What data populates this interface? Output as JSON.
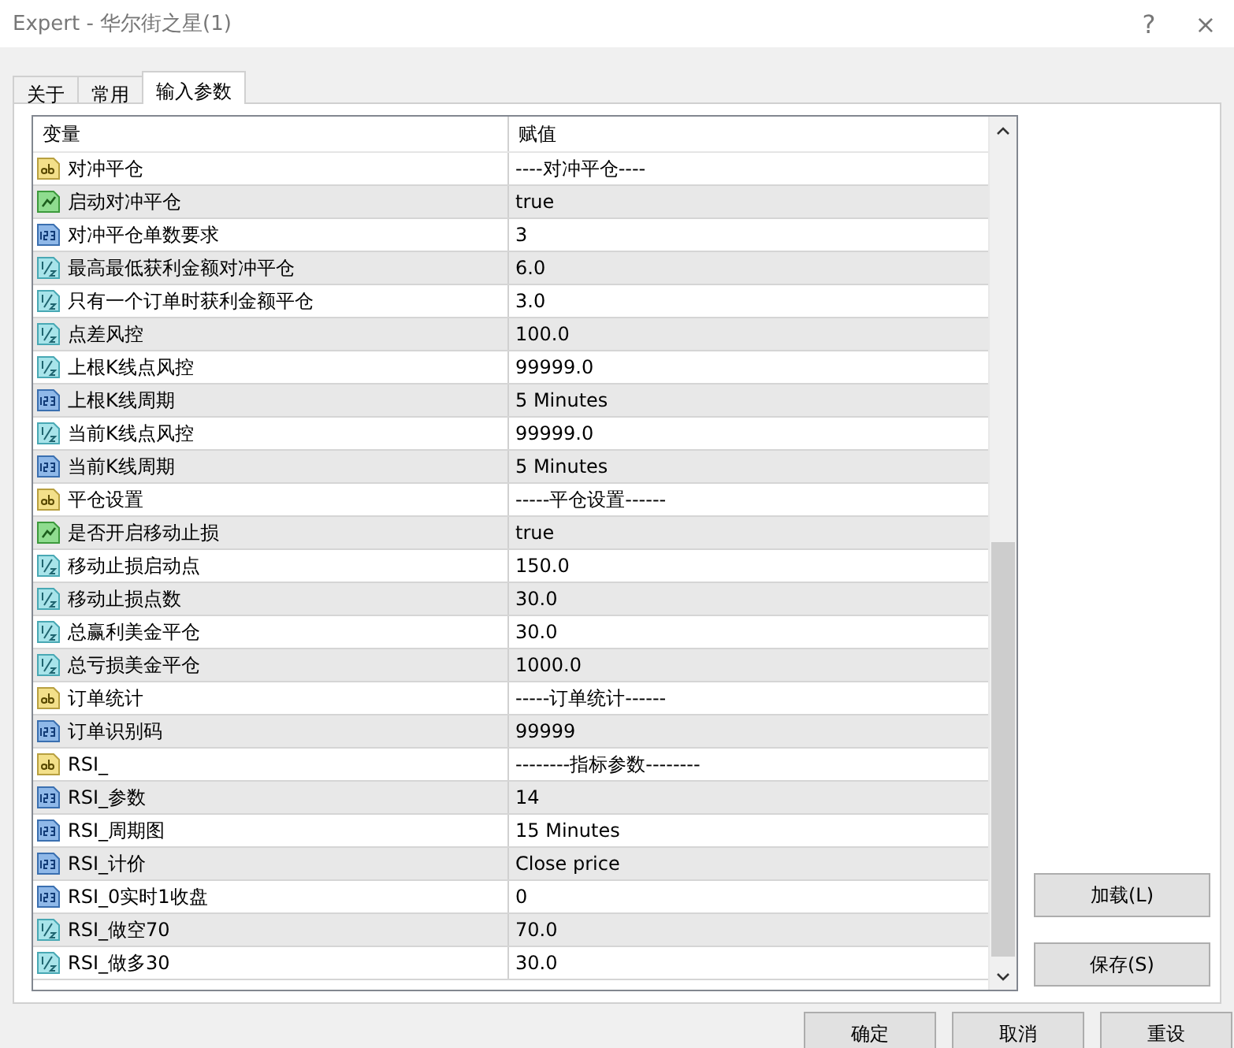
{
  "window": {
    "title": "Expert - 华尔街之星(1)",
    "help": "?",
    "close": "×"
  },
  "tabs": [
    {
      "label": "关于",
      "selected": false
    },
    {
      "label": "常用",
      "selected": false
    },
    {
      "label": "输入参数",
      "selected": true
    }
  ],
  "table": {
    "columns": [
      "变量",
      "赋值"
    ],
    "rows": [
      {
        "kind": "string",
        "name": "对冲平仓",
        "value": "----对冲平仓----"
      },
      {
        "kind": "bool",
        "name": "启动对冲平仓",
        "value": "true"
      },
      {
        "kind": "int",
        "name": "对冲平仓单数要求",
        "value": "3"
      },
      {
        "kind": "double",
        "name": "最高最低获利金额对冲平仓",
        "value": "6.0"
      },
      {
        "kind": "double",
        "name": "只有一个订单时获利金额平仓",
        "value": "3.0"
      },
      {
        "kind": "double",
        "name": "点差风控",
        "value": "100.0"
      },
      {
        "kind": "double",
        "name": "上根K线点风控",
        "value": "99999.0"
      },
      {
        "kind": "int",
        "name": "上根K线周期",
        "value": "5 Minutes"
      },
      {
        "kind": "double",
        "name": "当前K线点风控",
        "value": "99999.0"
      },
      {
        "kind": "int",
        "name": "当前K线周期",
        "value": "5 Minutes"
      },
      {
        "kind": "string",
        "name": "平仓设置",
        "value": "-----平仓设置------"
      },
      {
        "kind": "bool",
        "name": "是否开启移动止损",
        "value": "true"
      },
      {
        "kind": "double",
        "name": "移动止损启动点",
        "value": "150.0"
      },
      {
        "kind": "double",
        "name": "移动止损点数",
        "value": "30.0"
      },
      {
        "kind": "double",
        "name": "总赢利美金平仓",
        "value": "30.0"
      },
      {
        "kind": "double",
        "name": "总亏损美金平仓",
        "value": "1000.0"
      },
      {
        "kind": "string",
        "name": "订单统计",
        "value": "-----订单统计------"
      },
      {
        "kind": "int",
        "name": "订单识别码",
        "value": "99999"
      },
      {
        "kind": "string",
        "name": "RSI_",
        "value": "--------指标参数--------"
      },
      {
        "kind": "int",
        "name": "RSI_参数",
        "value": "14"
      },
      {
        "kind": "int",
        "name": "RSI_周期图",
        "value": "15 Minutes"
      },
      {
        "kind": "int",
        "name": "RSI_计价",
        "value": "Close price"
      },
      {
        "kind": "int",
        "name": "RSI_0实时1收盘",
        "value": "0"
      },
      {
        "kind": "double",
        "name": "RSI_做空70",
        "value": "70.0"
      },
      {
        "kind": "double",
        "name": "RSI_做多30",
        "value": "30.0"
      }
    ]
  },
  "side_buttons": [
    "加载(L)",
    "保存(S)"
  ],
  "buttons": [
    "确定",
    "取消",
    "重设"
  ]
}
